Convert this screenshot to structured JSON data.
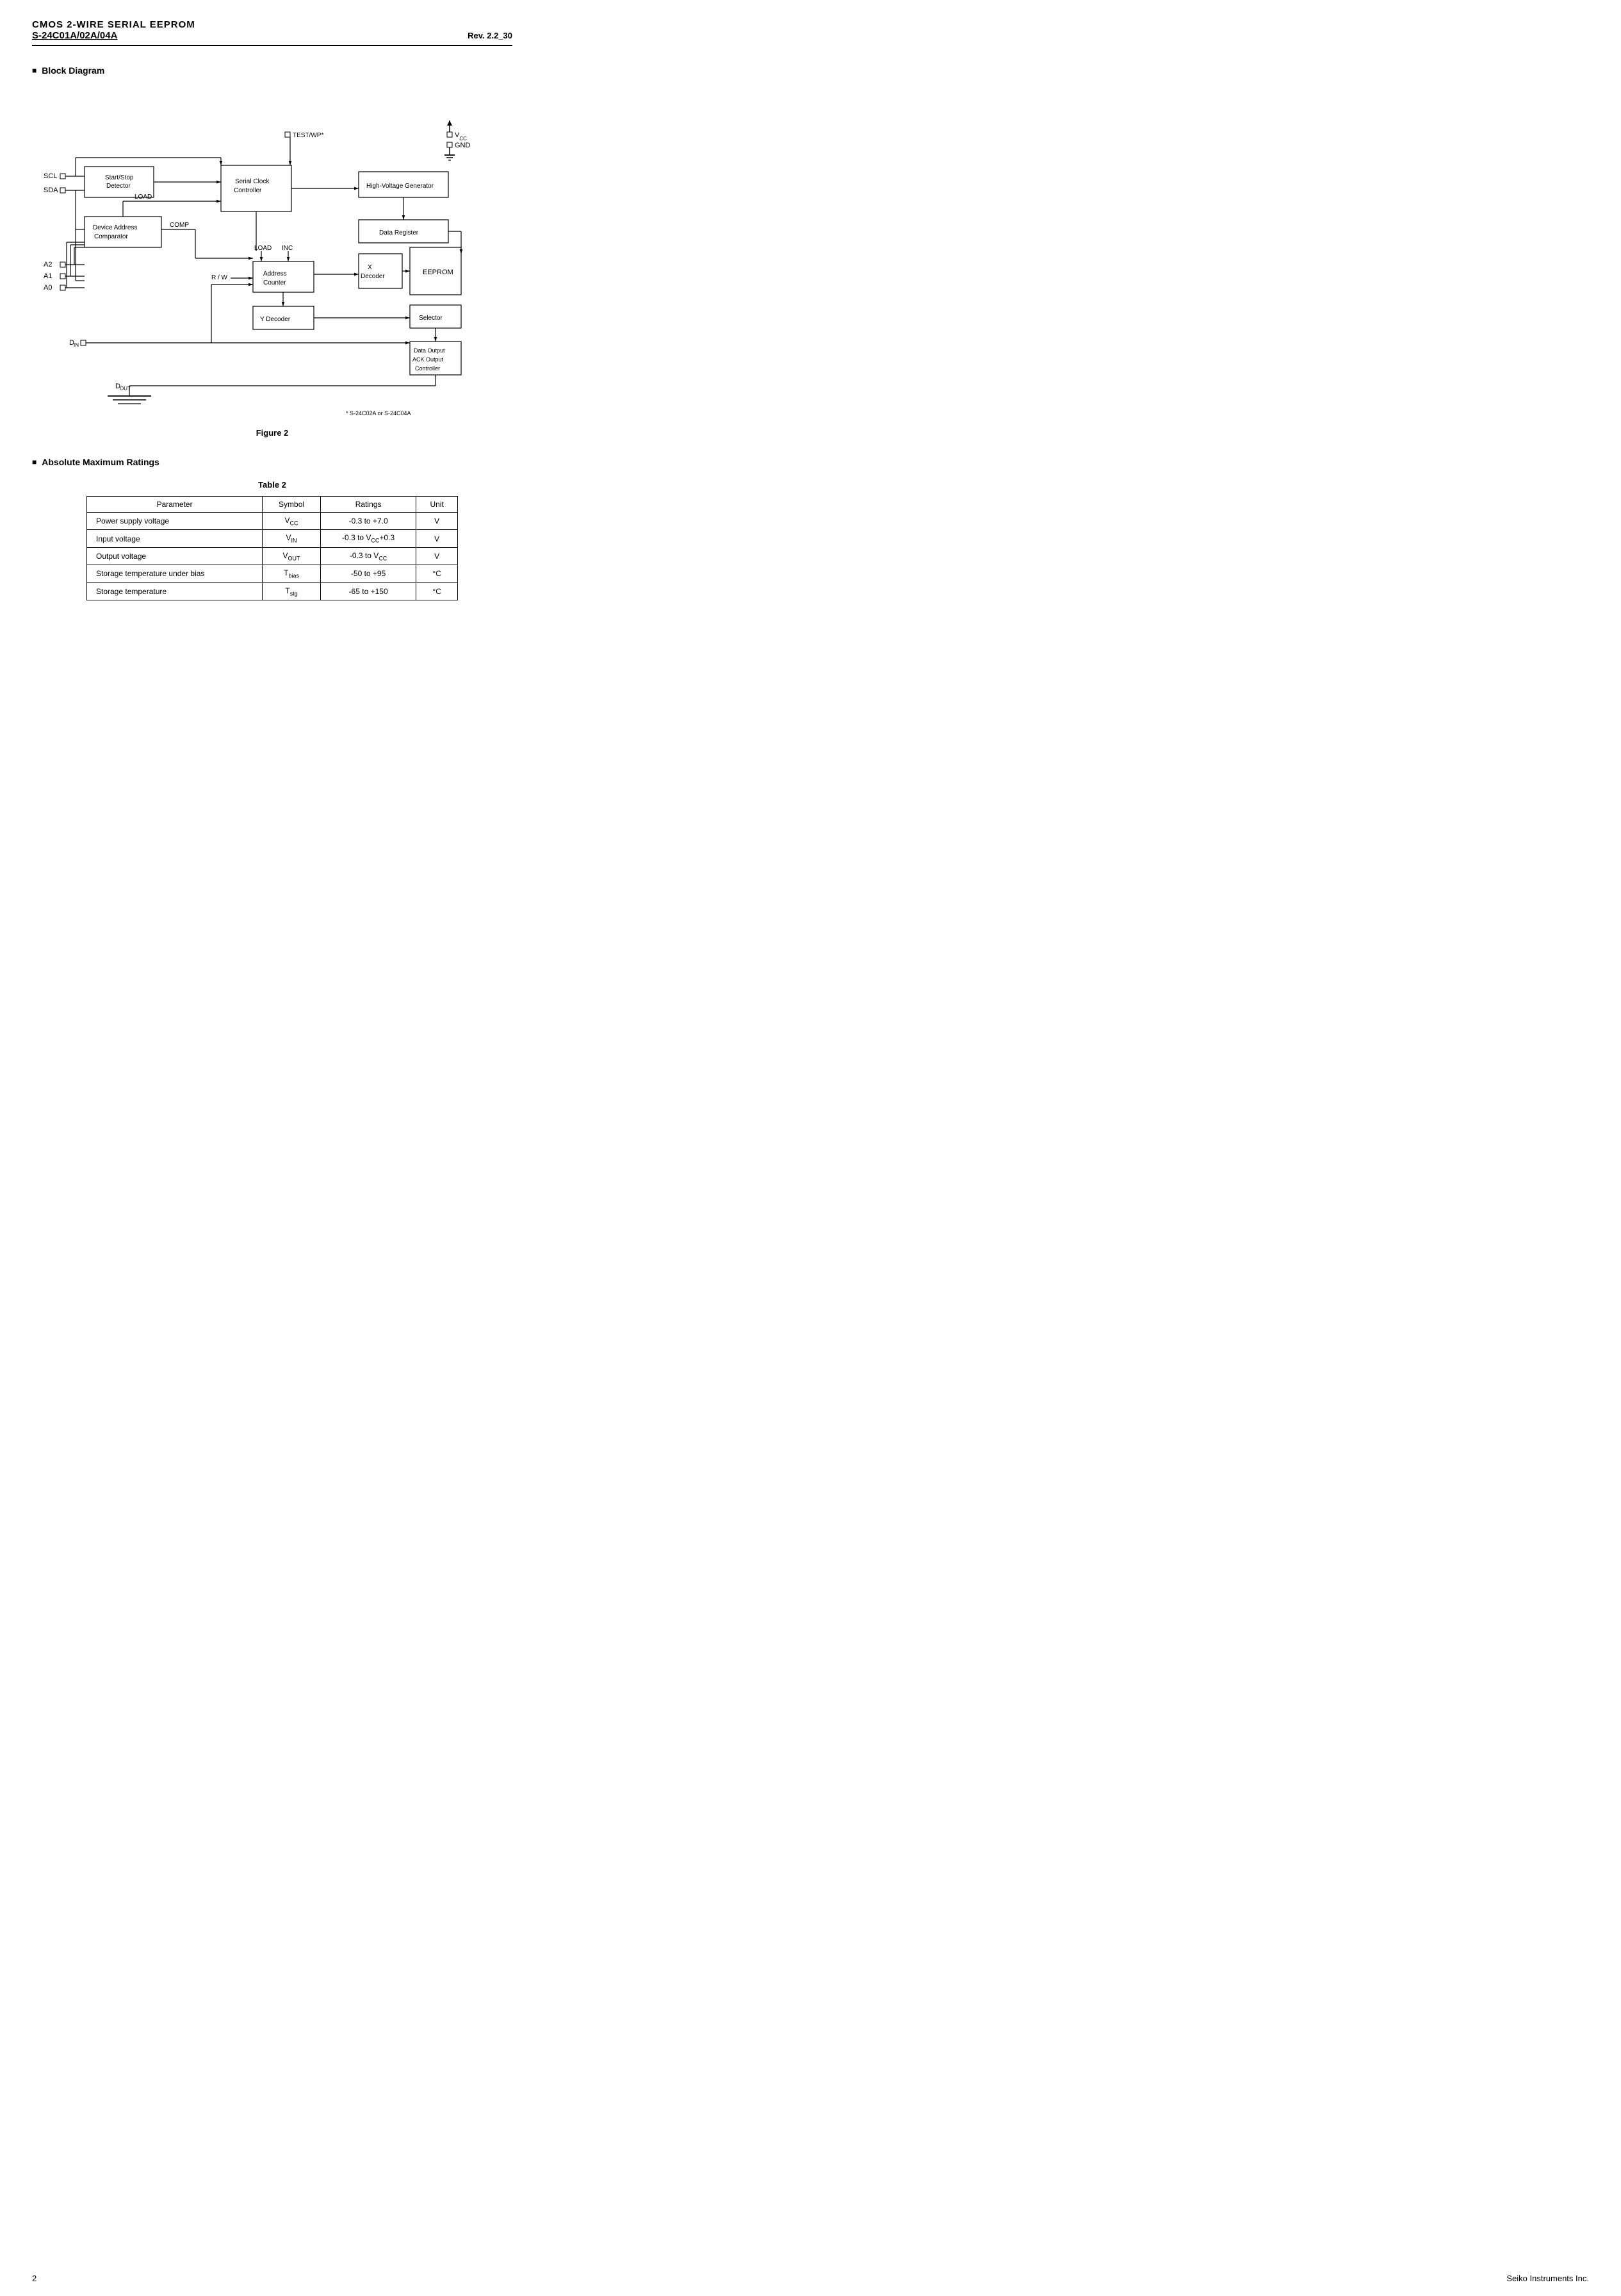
{
  "header": {
    "line1": "CMOS 2-WIRE SERIAL  EEPROM",
    "line2_model": "S-24C01A/02A/04A",
    "line2_rev": "Rev. 2.2_30"
  },
  "sections": {
    "block_diagram": {
      "heading": "Block Diagram",
      "figure_label": "Figure 2",
      "footnote": "*   S-24C02A or S-24C04A"
    },
    "absolute_max": {
      "heading": "Absolute Maximum Ratings",
      "table_label": "Table  2",
      "table": {
        "columns": [
          "Parameter",
          "Symbol",
          "Ratings",
          "Unit"
        ],
        "rows": [
          [
            "Power supply voltage",
            "VCC",
            "-0.3 to +7.0",
            "V"
          ],
          [
            "Input voltage",
            "VIN",
            "-0.3 to VCC+0.3",
            "V"
          ],
          [
            "Output voltage",
            "VOUT",
            "-0.3 to VCC",
            "V"
          ],
          [
            "Storage temperature under bias",
            "Tbias",
            "-50 to +95",
            "°C"
          ],
          [
            "Storage temperature",
            "Tstg",
            "-65 to +150",
            "°C"
          ]
        ]
      }
    }
  },
  "footer": {
    "page_number": "2",
    "company": "Seiko Instruments Inc."
  }
}
